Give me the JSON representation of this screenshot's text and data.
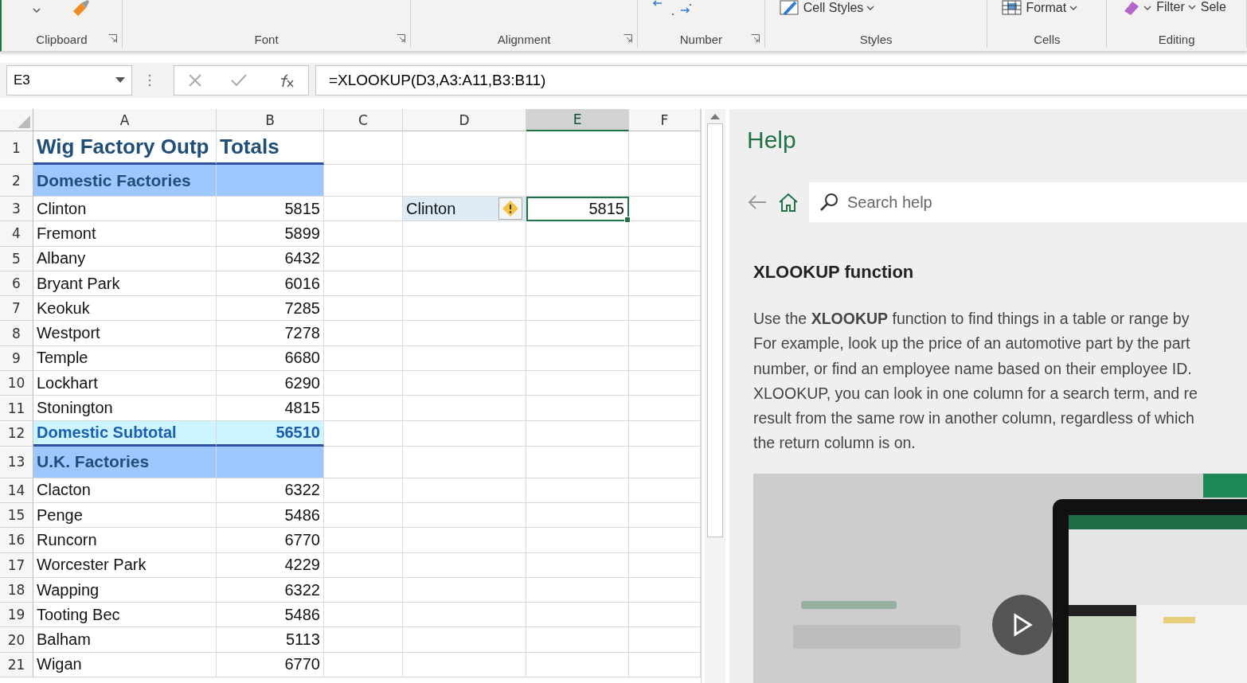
{
  "ribbon": {
    "groups": [
      {
        "label": "Clipboard",
        "launcher": true
      },
      {
        "label": "Font",
        "launcher": true
      },
      {
        "label": "Alignment",
        "launcher": true
      },
      {
        "label": "Number",
        "launcher": true
      },
      {
        "label": "Styles",
        "launcher": false,
        "items": [
          {
            "label": "Cell Styles",
            "kind": "styles"
          }
        ]
      },
      {
        "label": "Cells",
        "launcher": false,
        "items": [
          {
            "label": "Format",
            "kind": "format"
          }
        ]
      },
      {
        "label": "Editing",
        "launcher": false,
        "items": [
          {
            "kind": "eraser"
          },
          {
            "label": "Filter",
            "kind": "filter"
          },
          {
            "label": "Sele",
            "kind": "plain"
          }
        ]
      }
    ]
  },
  "formula_bar": {
    "name_box": "E3",
    "formula": "=XLOOKUP(D3,A3:A11,B3:B11)"
  },
  "columns": [
    {
      "label": "A",
      "selected": false
    },
    {
      "label": "B",
      "selected": false
    },
    {
      "label": "C",
      "selected": false
    },
    {
      "label": "D",
      "selected": false
    },
    {
      "label": "E",
      "selected": true
    },
    {
      "label": "F",
      "selected": false
    }
  ],
  "rows": [
    {
      "num": "1",
      "kind": "title",
      "a": "Wig Factory Outp",
      "b": "Totals"
    },
    {
      "num": "2",
      "kind": "section",
      "a": "Domestic Factories"
    },
    {
      "num": "3",
      "kind": "item",
      "a": "Clinton",
      "b": "5815",
      "d": "Clinton",
      "e": "5815",
      "warning": true,
      "e_selected": true
    },
    {
      "num": "4",
      "kind": "item",
      "a": "Fremont",
      "b": "5899"
    },
    {
      "num": "5",
      "kind": "item",
      "a": "Albany",
      "b": "6432"
    },
    {
      "num": "6",
      "kind": "item",
      "a": "Bryant Park",
      "b": "6016"
    },
    {
      "num": "7",
      "kind": "item",
      "a": "Keokuk",
      "b": "7285"
    },
    {
      "num": "8",
      "kind": "item",
      "a": "Westport",
      "b": "7278"
    },
    {
      "num": "9",
      "kind": "item",
      "a": "Temple",
      "b": "6680"
    },
    {
      "num": "10",
      "kind": "item",
      "a": "Lockhart",
      "b": "6290"
    },
    {
      "num": "11",
      "kind": "item",
      "a": "Stonington",
      "b": "4815"
    },
    {
      "num": "12",
      "kind": "subtotal",
      "a": "Domestic Subtotal",
      "b": "56510"
    },
    {
      "num": "13",
      "kind": "section",
      "a": "U.K. Factories"
    },
    {
      "num": "14",
      "kind": "item",
      "a": "Clacton",
      "b": "6322"
    },
    {
      "num": "15",
      "kind": "item",
      "a": "Penge",
      "b": "5486"
    },
    {
      "num": "16",
      "kind": "item",
      "a": "Runcorn",
      "b": "6770"
    },
    {
      "num": "17",
      "kind": "item",
      "a": "Worcester Park",
      "b": "4229"
    },
    {
      "num": "18",
      "kind": "item",
      "a": "Wapping",
      "b": "6322"
    },
    {
      "num": "19",
      "kind": "item",
      "a": "Tooting Bec",
      "b": "5486"
    },
    {
      "num": "20",
      "kind": "item",
      "a": "Balham",
      "b": "5113"
    },
    {
      "num": "21",
      "kind": "item",
      "a": "Wigan",
      "b": "6770"
    }
  ],
  "help": {
    "title": "Help",
    "search": {
      "placeholder": "Search help"
    },
    "heading": "XLOOKUP function",
    "lines": [
      "Use the **XLOOKUP** function to find things in a table or range by",
      "For example, look up the price of an automotive part by the part",
      "number, or find an employee name based on their employee ID.",
      "XLOOKUP, you can look in one column for a search term, and re",
      "result from the same row in another column, regardless of which",
      "the return column is on."
    ],
    "video": {
      "kind": "picture"
    }
  }
}
